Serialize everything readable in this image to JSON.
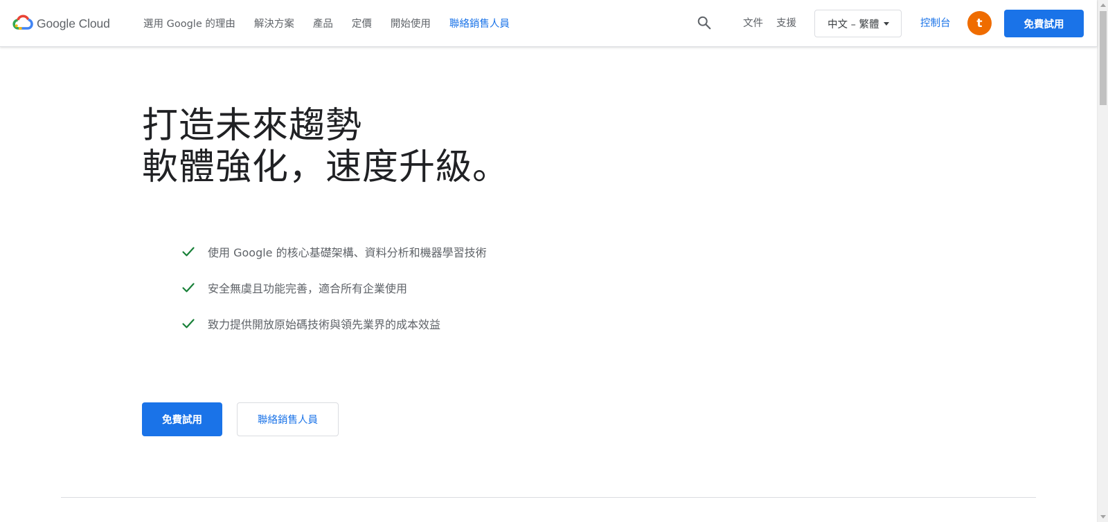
{
  "brand": {
    "name": "Google Cloud",
    "colors": {
      "blue": "#4285F4",
      "red": "#EA4335",
      "yellow": "#FBBC04",
      "green": "#34A853"
    }
  },
  "nav": {
    "items": [
      {
        "label": "選用 Google 的理由"
      },
      {
        "label": "解決方案"
      },
      {
        "label": "產品"
      },
      {
        "label": "定價"
      },
      {
        "label": "開始使用"
      },
      {
        "label": "聯絡銷售人員"
      }
    ]
  },
  "header": {
    "search_icon": "search-icon",
    "docs_label": "文件",
    "support_label": "支援",
    "language": "中文 – 繁體",
    "console_label": "控制台",
    "avatar_initial": "t",
    "avatar_color": "#EF6C00",
    "cta_label": "免費試用"
  },
  "hero": {
    "title_line1": "打造未來趨勢",
    "title_line2": "軟體強化，速度升級。",
    "features": [
      {
        "text": "使用 Google 的核心基礎架構、資料分析和機器學習技術",
        "icon": "check-icon"
      },
      {
        "text": "安全無虞且功能完善，適合所有企業使用",
        "icon": "check-icon"
      },
      {
        "text": "致力提供開放原始碼技術與領先業界的成本效益",
        "icon": "check-icon"
      }
    ],
    "primary_cta": "免費試用",
    "secondary_cta": "聯絡銷售人員"
  },
  "theme": {
    "accent": "#1A73E8",
    "check_color": "#188038",
    "text_primary": "#202124",
    "text_secondary": "#5F6368"
  }
}
